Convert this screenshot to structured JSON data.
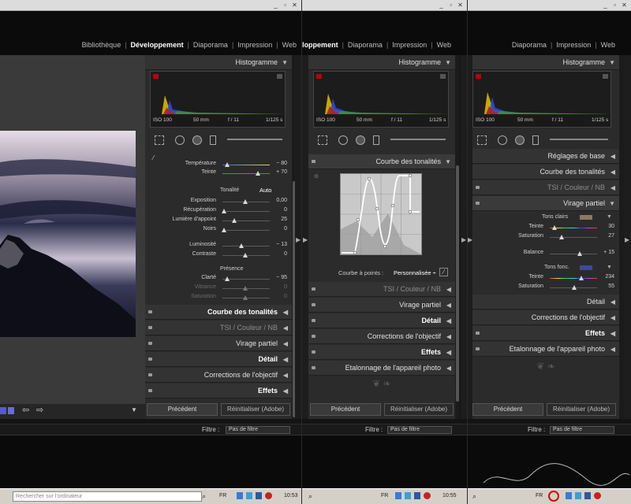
{
  "modules": [
    "Bibliothèque",
    "Développement",
    "Diaporama",
    "Impression",
    "Web"
  ],
  "active_module": "Développement",
  "histogram": {
    "title": "Histogramme",
    "iso": "ISO 100",
    "focal": "50 mm",
    "aperture": "f / 11",
    "shutter": "1/125 s"
  },
  "win1": {
    "basic": {
      "temp_label": "Température",
      "temp_val": "− 80",
      "tint_label": "Teinte",
      "tint_val": "+ 70",
      "tone_label": "Tonalité",
      "auto_label": "Auto",
      "exposure_label": "Exposition",
      "exposure_val": "0,00",
      "recovery_label": "Récupération",
      "recovery_val": "0",
      "fill_label": "Lumière d'appoint",
      "fill_val": "25",
      "blacks_label": "Noirs",
      "blacks_val": "0",
      "brightness_label": "Luminosité",
      "brightness_val": "− 13",
      "contrast_label": "Contraste",
      "contrast_val": "0",
      "presence_label": "Présence",
      "clarity_label": "Clarté",
      "clarity_val": "− 95",
      "vibrance_label": "Vibrance",
      "vibrance_val": "0",
      "saturation_label": "Saturation",
      "saturation_val": "0"
    },
    "sections": [
      {
        "label": "Courbe des tonalités",
        "bold": true
      },
      {
        "label": "TSI  /  Couleur  /  NB",
        "dim": true
      },
      {
        "label": "Virage partiel"
      },
      {
        "label": "Détail",
        "bold": true
      },
      {
        "label": "Corrections de l'objectif"
      },
      {
        "label": "Effets",
        "bold": true
      }
    ],
    "prev_button": "Précédent",
    "reset_button": "Réinitialiser (Adobe)",
    "filter_label": "Filtre :",
    "filter_value": "Pas de filtre",
    "search_placeholder": "Rechercher sur l'ordinateur",
    "lang": "FR",
    "clock": "10:53"
  },
  "win2": {
    "curve_title": "Courbe des tonalités",
    "point_curve_label": "Courbe à points :",
    "point_curve_value": "Personnalisée ÷",
    "sections": [
      {
        "label": "TSI  /  Couleur  /  NB",
        "dim": true
      },
      {
        "label": "Virage partiel"
      },
      {
        "label": "Détail",
        "bold": true
      },
      {
        "label": "Corrections de l'objectif"
      },
      {
        "label": "Effets",
        "bold": true
      },
      {
        "label": "Etalonnage de l'appareil photo"
      }
    ],
    "prev_button": "Précédent",
    "reset_button": "Réinitialiser (Adobe)",
    "filter_label": "Filtre :",
    "filter_value": "Pas de filtre",
    "lang": "FR",
    "clock": "10:55"
  },
  "win3": {
    "top_sections": [
      {
        "label": "Réglages de base"
      },
      {
        "label": "Courbe des tonalités"
      },
      {
        "label": "TSI  /  Couleur  /  NB",
        "dim": true
      }
    ],
    "split_title": "Virage partiel",
    "highlights_label": "Tons clairs",
    "hl_hue_label": "Teinte",
    "hl_hue_val": "30",
    "hl_sat_label": "Saturation",
    "hl_sat_val": "27",
    "balance_label": "Balance",
    "balance_val": "+ 15",
    "shadows_label": "Tons fonc.",
    "sh_hue_label": "Teinte",
    "sh_hue_val": "234",
    "sh_sat_label": "Saturation",
    "sh_sat_val": "55",
    "highlight_color": "#8a7a62",
    "shadow_color": "#3a4aa0",
    "sections": [
      {
        "label": "Détail"
      },
      {
        "label": "Corrections de l'objectif"
      },
      {
        "label": "Effets",
        "bold": true
      },
      {
        "label": "Etalonnage de l'appareil photo"
      }
    ],
    "prev_button": "Précédent",
    "reset_button": "Réinitialiser (Adobe)",
    "filter_label": "Filtre :",
    "filter_value": "Pas de filtre",
    "lang": "FR"
  }
}
